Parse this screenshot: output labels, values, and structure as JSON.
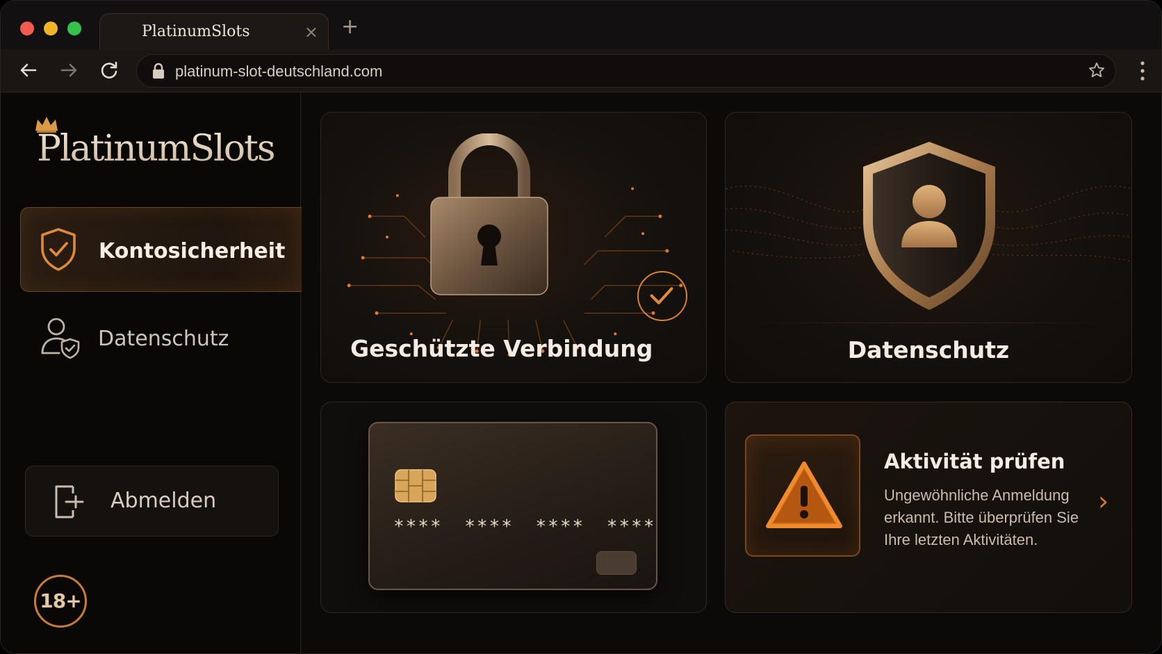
{
  "browser": {
    "tab_title": "PlatinumSlots",
    "tab_close": "×",
    "new_tab": "+",
    "url": "platinum-slot-deutschland.com",
    "menu": "⋮"
  },
  "sidebar": {
    "brand": "PlatinumSlots",
    "items": [
      {
        "label": "Kontosicherheit",
        "icon": "shield-check-icon",
        "active": true
      },
      {
        "label": "Datenschutz",
        "icon": "user-shield-icon",
        "active": false
      }
    ],
    "logout_label": "Abmelden",
    "age_badge": "18+"
  },
  "cards": {
    "connection": {
      "title": "Geschützte Verbindung",
      "icon": "padlock-icon",
      "status": "checkmark-icon"
    },
    "privacy": {
      "title": "Datenschutz",
      "icon": "user-shield-icon"
    },
    "payment": {
      "card_number": "**** **** **** ****",
      "icon": "credit-card-icon"
    },
    "activity": {
      "title": "Aktivität prüfen",
      "text": "Ungewöhnliche Anmeldung erkannt. Bitte überprüfen Sie Ihre letzten Aktivitäten.",
      "icon": "warning-icon",
      "chevron": "›"
    }
  },
  "colors": {
    "accent": "#d9822d",
    "background": "#0c0a09",
    "text": "#f4ece2"
  }
}
